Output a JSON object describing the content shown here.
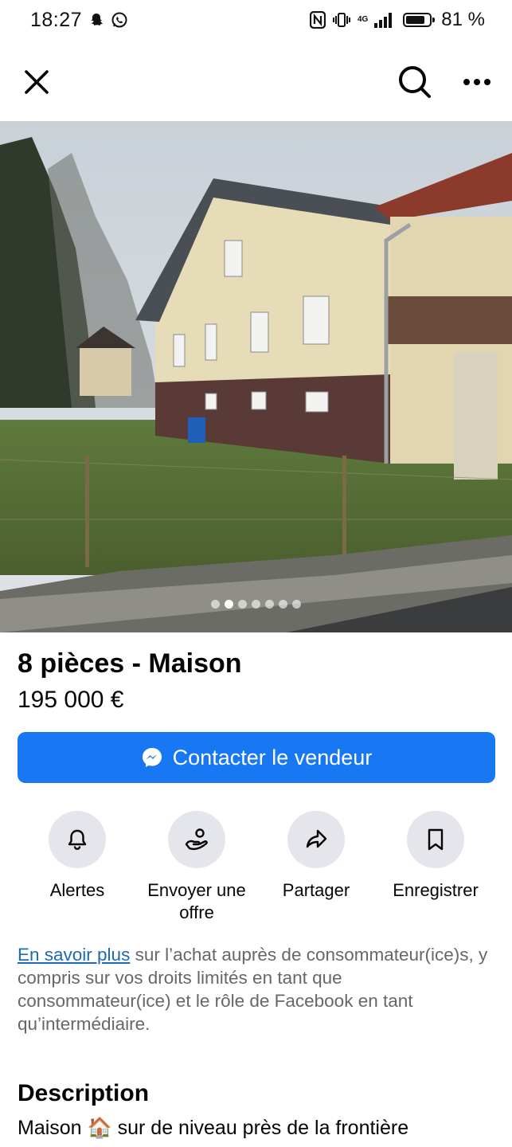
{
  "status_bar": {
    "time": "18:27",
    "battery_percent": "81 %",
    "network_label": "4G",
    "battery_level": 0.81
  },
  "nav": {
    "close_icon": "close-icon",
    "search_icon": "search-icon",
    "more_icon": "more-horizontal-icon"
  },
  "photo": {
    "page_count": 7,
    "current_index": 1
  },
  "listing": {
    "title": "8 pièces - Maison",
    "price": "195 000 €"
  },
  "contact_button": {
    "label": "Contacter le vendeur",
    "icon": "messenger-icon",
    "color": "#1877f2"
  },
  "actions": [
    {
      "label": "Alertes",
      "icon": "bell-icon"
    },
    {
      "label": "Envoyer une offre",
      "icon": "offer-hand-icon"
    },
    {
      "label": "Partager",
      "icon": "share-arrow-icon"
    },
    {
      "label": "Enregistrer",
      "icon": "bookmark-icon"
    }
  ],
  "info": {
    "link_text": "En savoir plus",
    "text": " sur l’achat auprès de consommateur(ice)s, y compris sur vos droits limités en tant que consommateur(ice) et le rôle de Facebook en tant qu’intermédiaire."
  },
  "description": {
    "heading": "Description",
    "text_before": "Maison ",
    "emoji": "🏠",
    "text_after": " sur de niveau près de la frontière"
  }
}
